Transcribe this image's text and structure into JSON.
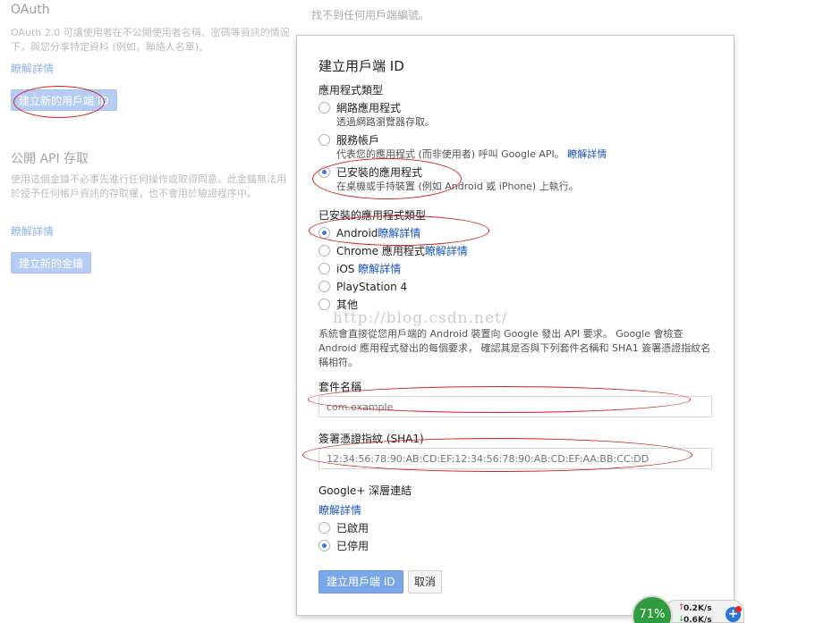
{
  "background": {
    "oauth_title": "OAuth",
    "oauth_desc": "OAuth 2.0 可讓使用者在不公開使用者名稱、密碼等資訊的情況下，與您分享特定資料 (例如，聯絡人名單)。",
    "learn_more_1": "瞭解詳情",
    "create_client_btn": "建立新的用戶端 ID",
    "api_title": "公開 API 存取",
    "api_desc": "使用這個金鑰不必事先進行任何操作或取得同意。此金鑰無法用於授予任何帳戶資訊的存取權，也不會用於驗證程序中。",
    "learn_more_2": "瞭解詳情",
    "create_key_btn": "建立新的金鑰",
    "no_clients": "找不到任何用戶端編號。"
  },
  "dialog": {
    "title": "建立用戶端 ID",
    "app_type_label": "應用程式類型",
    "app_types": [
      {
        "label": "網路應用程式",
        "sub": "透過網路瀏覽器存取。",
        "checked": false
      },
      {
        "label": "服務帳戶",
        "sub": "代表您的應用程式 (而非使用者) 呼叫 Google API。",
        "sub_link": "瞭解詳情",
        "checked": false
      },
      {
        "label": "已安裝的應用程式",
        "sub": "在桌機或手持裝置 (例如 Android 或 iPhone) 上執行。",
        "checked": true
      }
    ],
    "installed_type_label": "已安裝的應用程式類型",
    "installed_types": [
      {
        "label": "Android",
        "link": "瞭解詳情",
        "checked": true
      },
      {
        "label": "Chrome 應用程式",
        "link": "瞭解詳情",
        "checked": false
      },
      {
        "label": "iOS",
        "link": "瞭解詳情",
        "checked": false
      },
      {
        "label": "PlayStation 4",
        "link": "",
        "checked": false
      },
      {
        "label": "其他",
        "link": "",
        "checked": false
      }
    ],
    "info_text": "系統會直接從您用戶端的 Android 裝置向 Google 發出 API 要求。 Google 會檢查 Android 應用程式發出的每個要求， 確認其是否與下列套件名稱和 SHA1 簽署憑證指紋名稱相符。",
    "package_label": "套件名稱",
    "package_placeholder": "com.example",
    "sha1_label": "簽署憑證指紋 (SHA1)",
    "sha1_placeholder": "12:34:56:78:90:AB:CD:EF:12:34:56:78:90:AB:CD:EF:AA:BB:CC:DD",
    "deeplink_label": "Google+ 深層連結",
    "deeplink_learn": "瞭解詳情",
    "deeplink_options": [
      {
        "label": "已啟用",
        "checked": false
      },
      {
        "label": "已停用",
        "checked": true
      }
    ],
    "create_btn": "建立用戶端 ID",
    "cancel_btn": "取消"
  },
  "watermark": "http://blog.csdn.net/",
  "netspeed": {
    "percent": "71%",
    "up": "0.2K/s",
    "down": "0.6K/s"
  },
  "colors": {
    "primary_button": "#7aa6ea",
    "link": "#1a55c4",
    "annotation": "#d81e1e",
    "gauge": "#2f9d3e"
  }
}
